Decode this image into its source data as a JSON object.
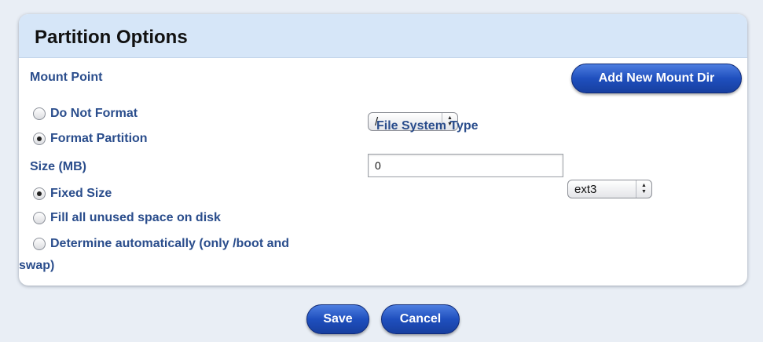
{
  "panel": {
    "title": "Partition Options"
  },
  "mount_point": {
    "label": "Mount Point",
    "selected": "/",
    "add_button": "Add New Mount Dir"
  },
  "format": {
    "options": [
      {
        "label": "Do Not Format",
        "selected": false
      },
      {
        "label": "Format Partition",
        "selected": true
      }
    ],
    "fs_label": "File System Type",
    "fs_selected": "ext3"
  },
  "size": {
    "label": "Size (MB)",
    "value": "0",
    "options": [
      {
        "label": "Fixed Size",
        "selected": true
      },
      {
        "label": "Fill all unused space on disk",
        "selected": false
      },
      {
        "label_line1": "Determine automatically (only /boot and",
        "label_line2": "swap)",
        "selected": false
      }
    ]
  },
  "actions": {
    "save": "Save",
    "cancel": "Cancel"
  },
  "icons": {
    "radio": "radio-icon",
    "select_arrows": "up-down-arrows-icon"
  }
}
